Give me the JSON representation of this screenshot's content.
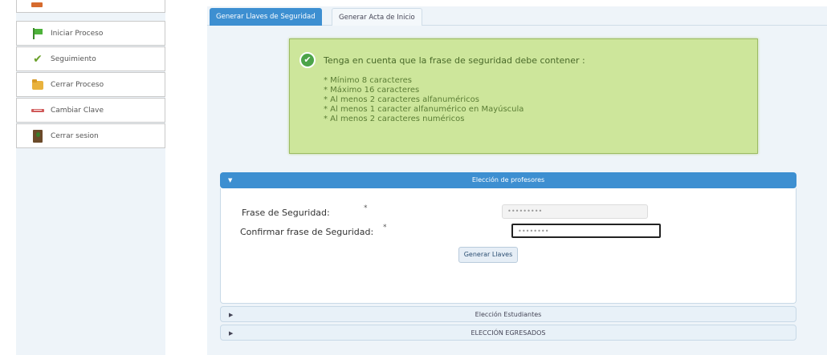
{
  "sidebar": {
    "items": [
      {
        "label": "Iniciar Proceso",
        "icon": "flag-icon"
      },
      {
        "label": "Seguimiento",
        "icon": "check-icon"
      },
      {
        "label": "Cerrar Proceso",
        "icon": "folder-icon"
      },
      {
        "label": "Cambiar Clave",
        "icon": "key-icon"
      },
      {
        "label": "Cerrar sesion",
        "icon": "door-icon"
      }
    ]
  },
  "tabs": [
    {
      "label": "Generar Llaves de Seguridad",
      "active": true
    },
    {
      "label": "Generar Acta de Inicio",
      "active": false
    }
  ],
  "notice": {
    "title": "Tenga en cuenta que la frase de seguridad debe contener :",
    "items": [
      "* Mínimo 8 caracteres",
      "* Máximo 16 caracteres",
      "* Al menos 2 caracteres alfanuméricos",
      "* Al menos 1 caracter alfanumérico en Mayúscula",
      "* Al menos 2 caracteres numéricos"
    ],
    "icon_check": "✔"
  },
  "accordion": {
    "sections": [
      {
        "title": "Elección de profesores",
        "open": true
      },
      {
        "title": "Elección Estudiantes",
        "open": false
      },
      {
        "title": "ELECCIÓN EGRESADOS",
        "open": false
      }
    ],
    "open_arrow": "▼",
    "closed_arrow": "▶"
  },
  "form": {
    "phrase_label": "Frase de Seguridad:",
    "confirm_label": "Confirmar frase de Seguridad:",
    "required_mark": "*",
    "phrase_value": "•••••••••",
    "confirm_value": "••••••••",
    "submit_label": "Generar Llaves"
  },
  "colors": {
    "accent": "#3d8fd1",
    "notice_bg": "#cde69b",
    "notice_text": "#5b7d35"
  }
}
